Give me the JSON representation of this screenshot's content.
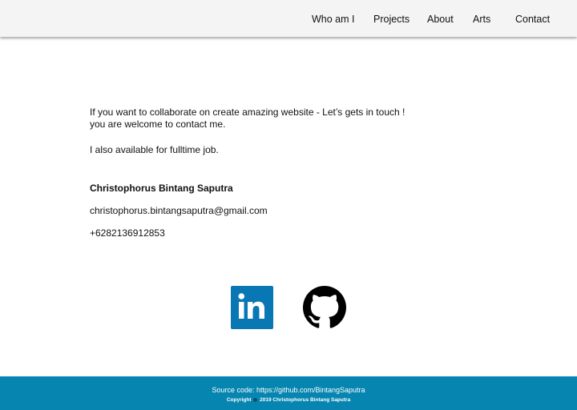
{
  "nav": {
    "items": [
      {
        "label": "Who am I"
      },
      {
        "label": "Projects"
      },
      {
        "label": "About"
      },
      {
        "label": "Arts"
      },
      {
        "label": "Contact"
      }
    ]
  },
  "contact": {
    "intro_line1": "If you want to collaborate on create amazing website - Let’s gets in touch !",
    "intro_line2": "you are welcome to contact me.",
    "fulltime": "I also available for fulltime job.",
    "name": "Christophorus Bintang Saputra",
    "email": "christophorus.bintangsaputra@gmail.com",
    "phone": "+6282136912853"
  },
  "social": {
    "linkedin_icon": "linkedin-icon",
    "github_icon": "github-icon"
  },
  "footer": {
    "source_prefix": "Source code: ",
    "source_url": "https://github.com/BintangSaputra",
    "copyright_word": "Copyright",
    "copyright_text": "2019 Christophorus Bintang Saputra"
  },
  "colors": {
    "navbar_bg": "#f4f4f4",
    "footer_bg": "#0685b0",
    "linkedin_blue": "#0a77b5"
  }
}
